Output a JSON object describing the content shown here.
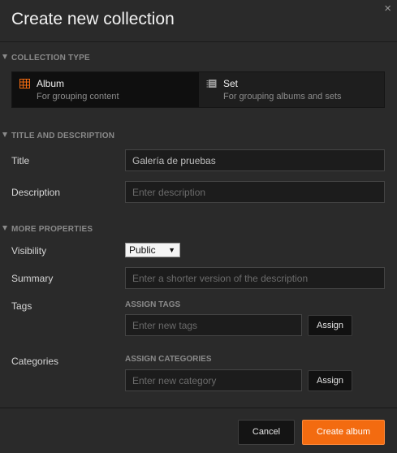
{
  "dialog": {
    "title": "Create new collection",
    "close_glyph": "×"
  },
  "sections": {
    "collection_type": "COLLECTION TYPE",
    "title_description": "TITLE AND DESCRIPTION",
    "more_properties": "MORE PROPERTIES"
  },
  "collection_types": [
    {
      "label": "Album",
      "description": "For grouping content",
      "icon": "album-icon",
      "selected": true
    },
    {
      "label": "Set",
      "description": "For grouping albums and sets",
      "icon": "set-icon",
      "selected": false
    }
  ],
  "fields": {
    "title": {
      "label": "Title",
      "value": "Galería de pruebas",
      "placeholder": ""
    },
    "description": {
      "label": "Description",
      "value": "",
      "placeholder": "Enter description"
    },
    "visibility": {
      "label": "Visibility",
      "selected": "Public"
    },
    "summary": {
      "label": "Summary",
      "value": "",
      "placeholder": "Enter a shorter version of the description"
    },
    "tags": {
      "label": "Tags",
      "subheading": "ASSIGN TAGS",
      "placeholder": "Enter new tags",
      "button": "Assign"
    },
    "categories": {
      "label": "Categories",
      "subheading": "ASSIGN CATEGORIES",
      "placeholder": "Enter new category",
      "button": "Assign"
    }
  },
  "footer": {
    "cancel": "Cancel",
    "create": "Create album"
  },
  "colors": {
    "accent": "#f36b10",
    "album_icon": "#f36b10",
    "set_icon": "#b0b0b0",
    "background": "#2a2a2a"
  }
}
